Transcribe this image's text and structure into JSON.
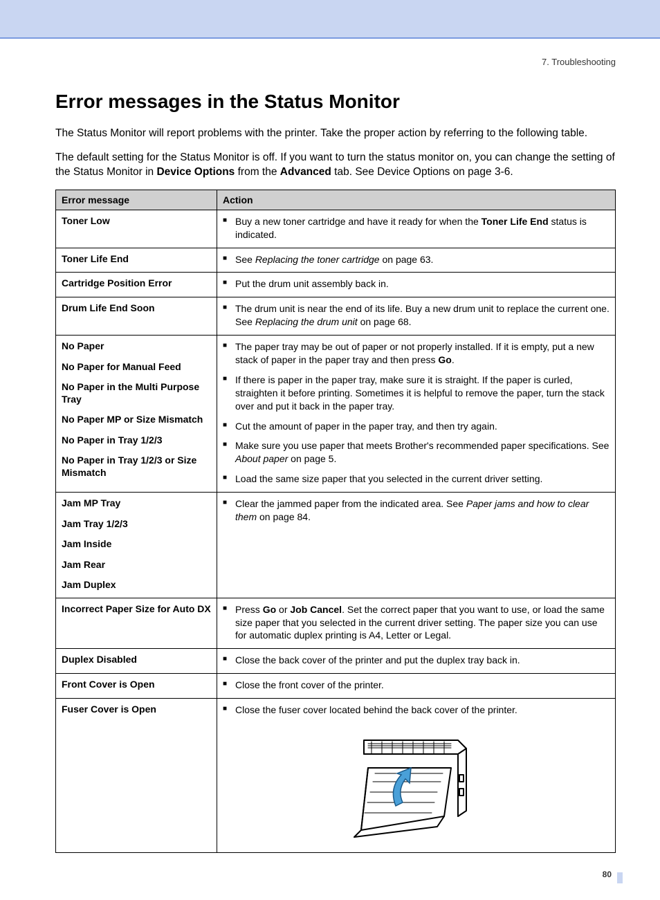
{
  "header": {
    "crumb": "7. Troubleshooting"
  },
  "title": "Error messages in the Status Monitor",
  "intro": [
    {
      "text": "The Status Monitor will report problems with the printer. Take the proper action by referring to the following table."
    },
    {
      "parts": [
        {
          "t": "The default setting for the Status Monitor is off. If you want to turn the status monitor on, you can change the setting of the Status Monitor in "
        },
        {
          "t": "Device Options",
          "b": true
        },
        {
          "t": " from the "
        },
        {
          "t": "Advanced",
          "b": true
        },
        {
          "t": " tab. See Device Options on page 3-6."
        }
      ]
    }
  ],
  "table": {
    "headers": [
      "Error message",
      "Action"
    ],
    "rows": [
      {
        "errors": [
          "Toner Low"
        ],
        "actions": [
          [
            {
              "t": "Buy a new toner cartridge and have it ready for when the "
            },
            {
              "t": "Toner Life End",
              "b": true
            },
            {
              "t": " status is indicated."
            }
          ]
        ]
      },
      {
        "errors": [
          "Toner Life End"
        ],
        "actions": [
          [
            {
              "t": "See "
            },
            {
              "t": "Replacing the toner cartridge",
              "i": true
            },
            {
              "t": " on page 63."
            }
          ]
        ]
      },
      {
        "errors": [
          "Cartridge Position Error"
        ],
        "actions": [
          [
            {
              "t": "Put the drum unit assembly back in."
            }
          ]
        ]
      },
      {
        "errors": [
          "Drum Life End Soon"
        ],
        "actions": [
          [
            {
              "t": "The drum unit is near the end of its life. Buy a new drum unit to replace the current one. See "
            },
            {
              "t": "Replacing the drum unit",
              "i": true
            },
            {
              "t": " on page 68."
            }
          ]
        ]
      },
      {
        "errors": [
          "No Paper",
          "No Paper for Manual Feed",
          "No Paper in the Multi Purpose Tray",
          "No Paper MP or Size Mismatch",
          "No Paper in Tray 1/2/3",
          "No Paper in Tray 1/2/3 or Size Mismatch"
        ],
        "actions": [
          [
            {
              "t": "The paper tray may be out of paper or not properly installed. If it is empty, put a new stack of paper in the paper tray and then press "
            },
            {
              "t": "Go",
              "b": true
            },
            {
              "t": "."
            }
          ],
          [
            {
              "t": "If there is paper in the paper tray, make sure it is straight. If the paper is curled, straighten it before printing. Sometimes it is helpful to remove the paper, turn the stack over and put it back in the paper tray."
            }
          ],
          [
            {
              "t": "Cut the amount of paper in the paper tray, and then try again."
            }
          ],
          [
            {
              "t": "Make sure you use paper that meets Brother's recommended paper specifications. See "
            },
            {
              "t": "About paper",
              "i": true
            },
            {
              "t": " on page 5."
            }
          ],
          [
            {
              "t": "Load the same size paper that you selected in the current driver setting."
            }
          ]
        ]
      },
      {
        "errors": [
          "Jam MP Tray",
          "Jam Tray 1/2/3",
          "Jam Inside",
          "Jam Rear",
          "Jam Duplex"
        ],
        "actions": [
          [
            {
              "t": "Clear the jammed paper from the indicated area. See "
            },
            {
              "t": "Paper jams and how to clear them",
              "i": true
            },
            {
              "t": " on page 84."
            }
          ]
        ]
      },
      {
        "errors": [
          "Incorrect Paper Size for Auto DX"
        ],
        "actions": [
          [
            {
              "t": "Press "
            },
            {
              "t": "Go",
              "b": true
            },
            {
              "t": " or "
            },
            {
              "t": "Job Cancel",
              "b": true
            },
            {
              "t": ". Set the correct paper that you want to use, or load the same size paper that you selected in the current driver setting. The paper size you can use for automatic duplex printing is A4, Letter or Legal."
            }
          ]
        ]
      },
      {
        "errors": [
          "Duplex Disabled"
        ],
        "actions": [
          [
            {
              "t": "Close the back cover of the printer and put the duplex tray back in."
            }
          ]
        ]
      },
      {
        "errors": [
          "Front Cover is Open"
        ],
        "actions": [
          [
            {
              "t": "Close the front cover of the printer."
            }
          ]
        ]
      },
      {
        "errors": [
          "Fuser Cover is Open"
        ],
        "actions": [
          [
            {
              "t": "Close the fuser cover located behind the back cover of the printer."
            }
          ]
        ],
        "illustration": true
      }
    ]
  },
  "page_number": "80"
}
